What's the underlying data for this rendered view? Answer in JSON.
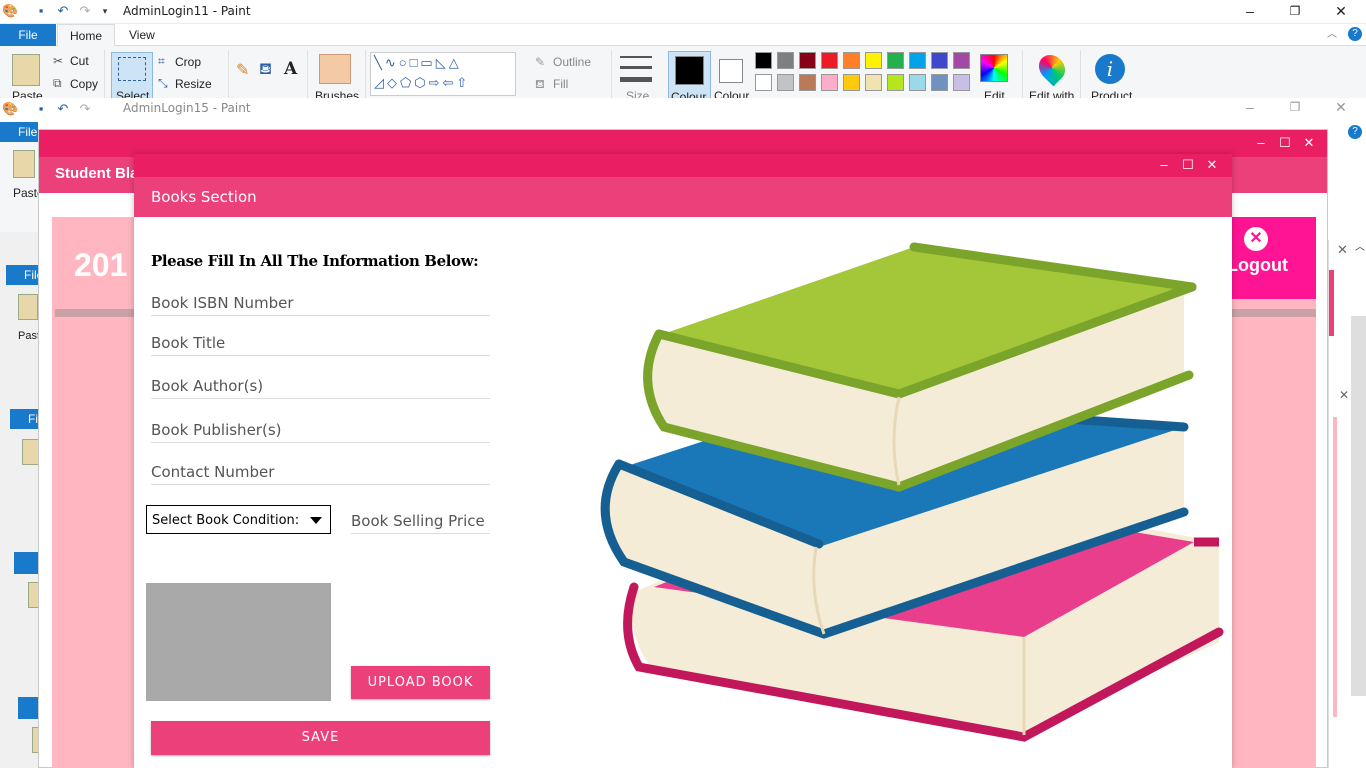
{
  "paint1": {
    "title": "AdminLogin11 - Paint",
    "tabs": [
      "File",
      "Home",
      "View"
    ],
    "clipboard": {
      "paste": "Paste",
      "cut": "Cut",
      "copy": "Copy"
    },
    "image": {
      "select": "Select",
      "crop": "Crop",
      "resize": "Resize"
    },
    "brushes": "Brushes",
    "shapes": {
      "outline": "Outline",
      "fill": "Fill"
    },
    "size": "Size",
    "colour1": "Colour",
    "colour2": "Colour",
    "edit_colours": "Edit",
    "edit_with": "Edit with",
    "product": "Product"
  },
  "paint2": {
    "title": "AdminLogin15 - Paint",
    "file_tab": "File",
    "paste": "Paste"
  },
  "fragments": {
    "file": "File",
    "paste": "Paste"
  },
  "student_window": {
    "header": "Student Bla",
    "year_text": "201",
    "logout": "Logout"
  },
  "books_dialog": {
    "header": "Books Section",
    "instruction": "Please Fill In All The Information Below:",
    "fields": {
      "isbn": "Book ISBN Number",
      "title": "Book Title",
      "authors": "Book Author(s)",
      "publishers": "Book Publisher(s)",
      "contact": "Contact Number"
    },
    "condition_select": "Select Book Condition:",
    "price": "Book Selling Price",
    "upload_button": "UPLOAD BOOK",
    "save_button": "SAVE"
  },
  "colors": {
    "accent": "#e91e63",
    "header_pink": "#ec407a",
    "bg_pink": "#ffb6c1",
    "logout_pink": "#ff1493",
    "paint_blue": "#1979ca"
  },
  "palette": [
    "#000000",
    "#7f7f7f",
    "#880015",
    "#ed1c24",
    "#ff7f27",
    "#fff200",
    "#22b14c",
    "#00a2e8",
    "#3f48cc",
    "#a349a4",
    "#ffffff",
    "#c3c3c3",
    "#b97a57",
    "#ffaec9",
    "#ffc90e",
    "#efe4b0",
    "#b5e61d",
    "#99d9ea",
    "#7092be",
    "#c8bfe7"
  ]
}
